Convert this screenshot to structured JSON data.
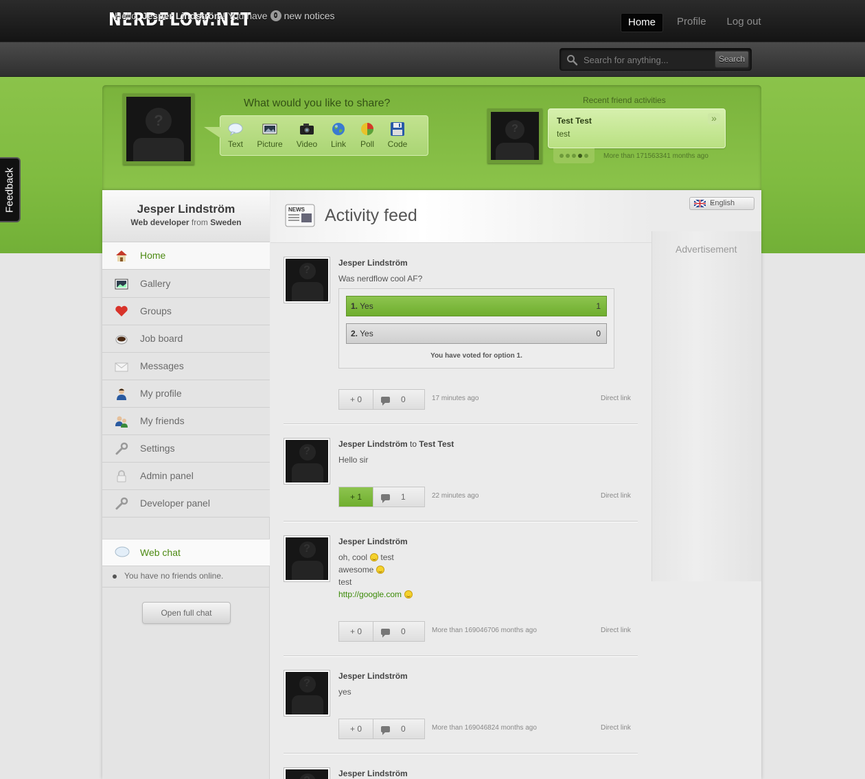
{
  "app": {
    "logo": "NERDFLOW.NET"
  },
  "topnav": [
    {
      "label": "Home",
      "active": true
    },
    {
      "label": "Profile",
      "active": false
    },
    {
      "label": "Log out",
      "active": false
    }
  ],
  "greeting": {
    "prefix": "Hello,",
    "name": "Jesper Lindström",
    "middle": "! You have",
    "count": "0",
    "suffix": "new notices"
  },
  "search": {
    "placeholder": "Search for anything...",
    "button": "Search"
  },
  "share": {
    "title": "What would you like to share?",
    "items": [
      {
        "label": "Text",
        "icon": "text-bubble-icon"
      },
      {
        "label": "Picture",
        "icon": "picture-icon"
      },
      {
        "label": "Video",
        "icon": "camera-icon"
      },
      {
        "label": "Link",
        "icon": "globe-icon"
      },
      {
        "label": "Poll",
        "icon": "pie-chart-icon"
      },
      {
        "label": "Code",
        "icon": "floppy-disk-icon"
      }
    ]
  },
  "recent": {
    "title": "Recent friend activities",
    "name": "Test Test",
    "text": "test",
    "next": "»",
    "time": "More than 171563341 months ago",
    "active_dot": 3
  },
  "feedback": {
    "label": "Feedback"
  },
  "profile": {
    "name": "Jesper Lindström",
    "role": "Web developer",
    "from": "from",
    "country": "Sweden"
  },
  "sidebar": {
    "items": [
      {
        "label": "Home",
        "icon": "home-icon",
        "active": true
      },
      {
        "label": "Gallery",
        "icon": "gallery-icon"
      },
      {
        "label": "Groups",
        "icon": "heart-icon"
      },
      {
        "label": "Job board",
        "icon": "coffee-icon"
      },
      {
        "label": "Messages",
        "icon": "envelope-icon"
      },
      {
        "label": "My profile",
        "icon": "user-icon"
      },
      {
        "label": "My friends",
        "icon": "users-icon"
      },
      {
        "label": "Settings",
        "icon": "wrench-icon"
      },
      {
        "label": "Admin panel",
        "icon": "lock-icon"
      },
      {
        "label": "Developer panel",
        "icon": "wrench-icon"
      }
    ]
  },
  "chat": {
    "title": "Web chat",
    "empty": "You have no friends online.",
    "open": "Open full chat"
  },
  "feed": {
    "title": "Activity feed",
    "language": "English",
    "ad_label": "Advertisement",
    "direct_link": "Direct link"
  },
  "posts": [
    {
      "author": "Jesper Lindström",
      "text": "Was nerdflow cool AF?",
      "poll": {
        "options": [
          {
            "num": "1.",
            "label": "Yes",
            "votes": "1"
          },
          {
            "num": "2.",
            "label": "Yes",
            "votes": "0"
          }
        ],
        "voted": "You have voted for option 1."
      },
      "likes": "+ 0",
      "comments": "0",
      "time": "17 minutes ago"
    },
    {
      "author": "Jesper Lindström",
      "to_word": "to",
      "to": "Test Test",
      "text": "Hello sir",
      "likes": "+ 1",
      "comments": "1",
      "time": "22 minutes ago"
    },
    {
      "author": "Jesper Lindström",
      "lines": [
        "oh, cool",
        "test",
        "awesome",
        "test",
        "http://google.com"
      ],
      "likes": "+ 0",
      "comments": "0",
      "time": "More than 169046706 months ago"
    },
    {
      "author": "Jesper Lindström",
      "text": "yes",
      "likes": "+ 0",
      "comments": "0",
      "time": "More than 169046824 months ago"
    },
    {
      "author": "Jesper Lindström"
    }
  ],
  "colors": {
    "accent_green": "#8bc34a",
    "link_green": "#4d8a13",
    "dark_bar": "#1e1e1e"
  }
}
